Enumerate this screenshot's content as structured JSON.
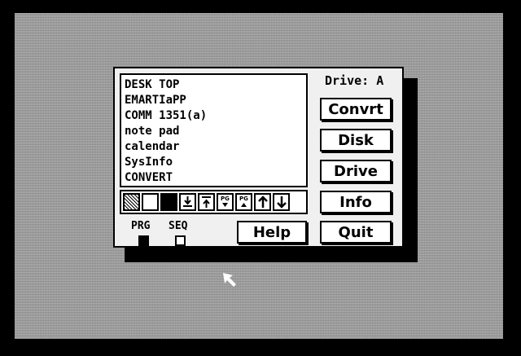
{
  "files": [
    "DESK TOP",
    "EMARTIaPP",
    "COMM 1351(a)",
    "note pad",
    "calendar",
    "SysInfo",
    "CONVERT"
  ],
  "drive": {
    "label": "Drive: A"
  },
  "buttons": {
    "convert": "Convrt",
    "disk": "Disk",
    "drive": "Drive",
    "info": "Info",
    "quit": "Quit",
    "help": "Help"
  },
  "file_types": {
    "prg": "PRG",
    "seq": "SEQ",
    "prg_checked": true,
    "seq_checked": false
  },
  "toolbar_icons": [
    "pattern-icon",
    "empty-box-icon",
    "filled-box-icon",
    "move-down-line-icon",
    "move-up-line-icon",
    "page-down-icon",
    "page-up-icon",
    "arrow-up-icon",
    "arrow-down-icon"
  ],
  "toolbar_text": {
    "page_down": "PG",
    "page_up": "PG"
  }
}
